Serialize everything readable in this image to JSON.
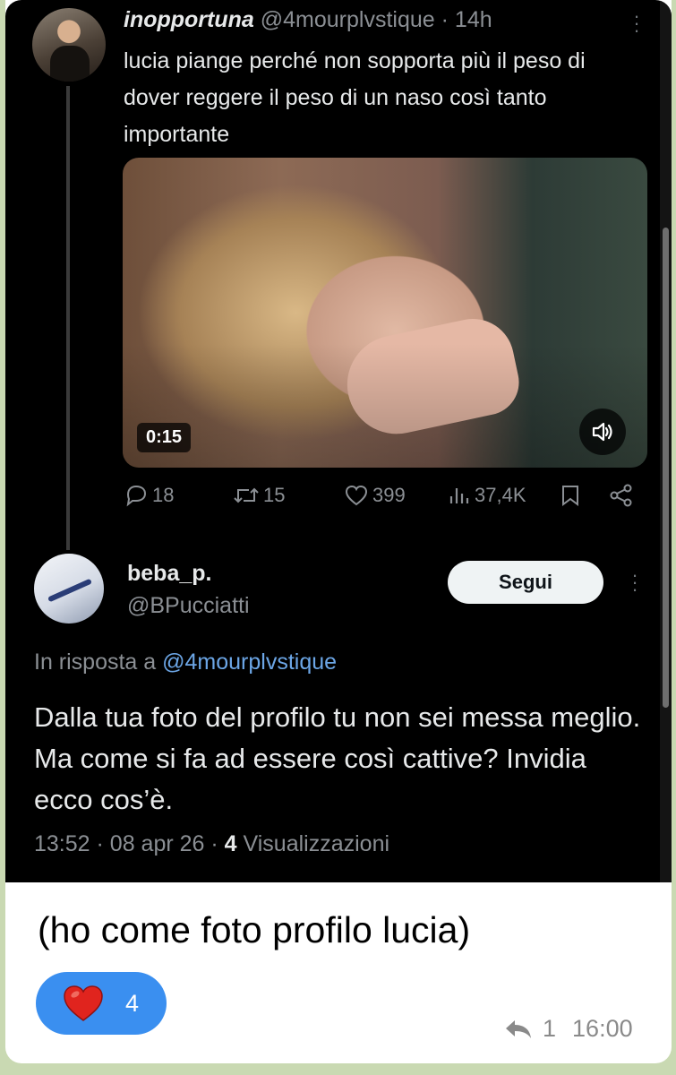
{
  "tweet1": {
    "display_name": "inopportuna",
    "handle": "@4mourplvstique",
    "time": "14h",
    "text": "lucia piange perché non sopporta più il peso di dover reggere il peso di un naso così tanto importante",
    "video_duration": "0:15",
    "stats": {
      "replies": "18",
      "retweets": "15",
      "likes": "399",
      "views": "37,4K"
    }
  },
  "tweet2": {
    "display_name": "beba_p.",
    "handle": "@BPucciatti",
    "follow_label": "Segui",
    "reply_prefix": "In risposta a",
    "reply_handle": "@4mourplvstique",
    "text": "Dalla tua foto del profilo tu non sei messa meglio. Ma come si fa ad essere così cattive? Invidia ecco cos’è.",
    "time": "13:52",
    "date": "08 apr 26",
    "views_count": "4",
    "views_label": "Visualizzazioni"
  },
  "message": {
    "caption": "(ho come foto profilo lucia)",
    "reaction_count": "4",
    "reply_count": "1",
    "time": "16:00"
  },
  "colors": {
    "chat_background": "#c9d9b2",
    "reaction_blue": "#3a8ff0",
    "link_blue": "#6ca6e6",
    "heart_red": "#e0241e"
  }
}
